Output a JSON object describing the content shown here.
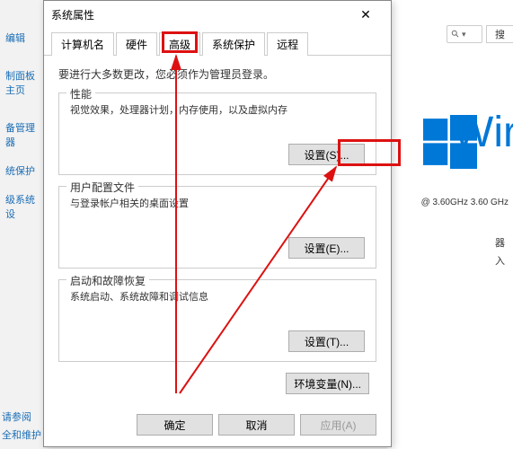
{
  "dialog": {
    "title": "系统属性",
    "tabs": [
      "计算机名",
      "硬件",
      "高级",
      "系统保护",
      "远程"
    ],
    "active_tab": 2,
    "note": "要进行大多数更改，您必须作为管理员登录。",
    "groups": {
      "performance": {
        "title": "性能",
        "desc": "视觉效果，处理器计划，内存使用，以及虚拟内存",
        "btn": "设置(S)..."
      },
      "profiles": {
        "title": "用户配置文件",
        "desc": "与登录帐户相关的桌面设置",
        "btn": "设置(E)..."
      },
      "startup": {
        "title": "启动和故障恢复",
        "desc": "系统启动、系统故障和调试信息",
        "btn": "设置(T)..."
      }
    },
    "env_btn": "环境变量(N)...",
    "actions": {
      "ok": "确定",
      "cancel": "取消",
      "apply": "应用(A)"
    }
  },
  "sidebar": {
    "items": [
      "编辑",
      "制面板主页",
      "备管理器",
      "统保护",
      "级系统设"
    ]
  },
  "bg": {
    "dropdown": "搜",
    "wintext": "Wir",
    "cpu": "@ 3.60GHz  3.60 GHz",
    "ctrl1": "器",
    "ctrl2": "入",
    "bottom1": "请参阅",
    "bottom2": "全和维护"
  }
}
